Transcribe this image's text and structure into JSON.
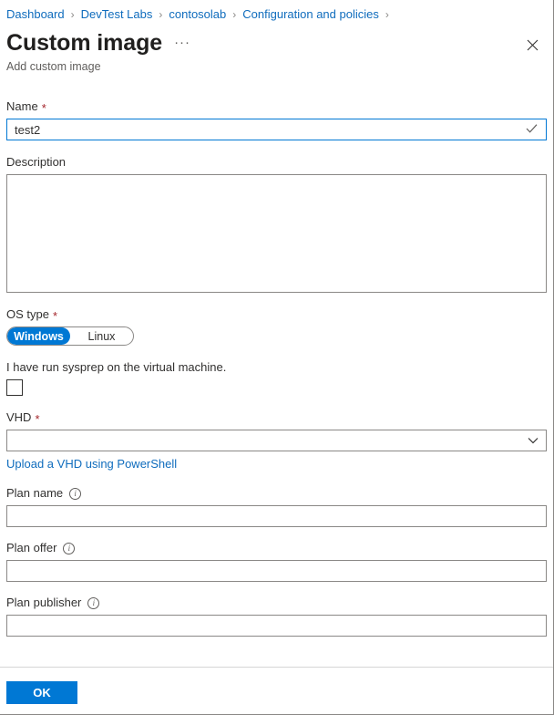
{
  "breadcrumb": {
    "separator": "›",
    "items": [
      {
        "label": "Dashboard"
      },
      {
        "label": "DevTest Labs"
      },
      {
        "label": "contosolab"
      },
      {
        "label": "Configuration and policies"
      }
    ]
  },
  "header": {
    "title": "Custom image",
    "ellipsis": "···",
    "subtitle": "Add custom image",
    "close_icon": "close-icon"
  },
  "form": {
    "name": {
      "label": "Name",
      "required": "*",
      "value": "test2",
      "placeholder": "",
      "valid_icon": "checkmark-icon"
    },
    "description": {
      "label": "Description",
      "value": "",
      "placeholder": ""
    },
    "os_type": {
      "label": "OS type",
      "required": "*",
      "selected": "Windows",
      "options": [
        "Windows",
        "Linux"
      ]
    },
    "sysprep": {
      "label": "I have run sysprep on the virtual machine.",
      "checked": false
    },
    "vhd": {
      "label": "VHD",
      "required": "*",
      "value": "",
      "chevron_icon": "chevron-down-icon",
      "link_text": "Upload a VHD using PowerShell"
    },
    "plan_name": {
      "label": "Plan name",
      "info_icon": "info-icon",
      "value": "",
      "placeholder": ""
    },
    "plan_offer": {
      "label": "Plan offer",
      "info_icon": "info-icon",
      "value": "",
      "placeholder": ""
    },
    "plan_publisher": {
      "label": "Plan publisher",
      "info_icon": "info-icon",
      "value": "",
      "placeholder": ""
    }
  },
  "footer": {
    "ok_label": "OK"
  },
  "colors": {
    "accent": "#0078d4",
    "link": "#0f6cbd",
    "required": "#a4262c",
    "border": "#8a8886",
    "text": "#323130",
    "muted": "#605e5c"
  }
}
